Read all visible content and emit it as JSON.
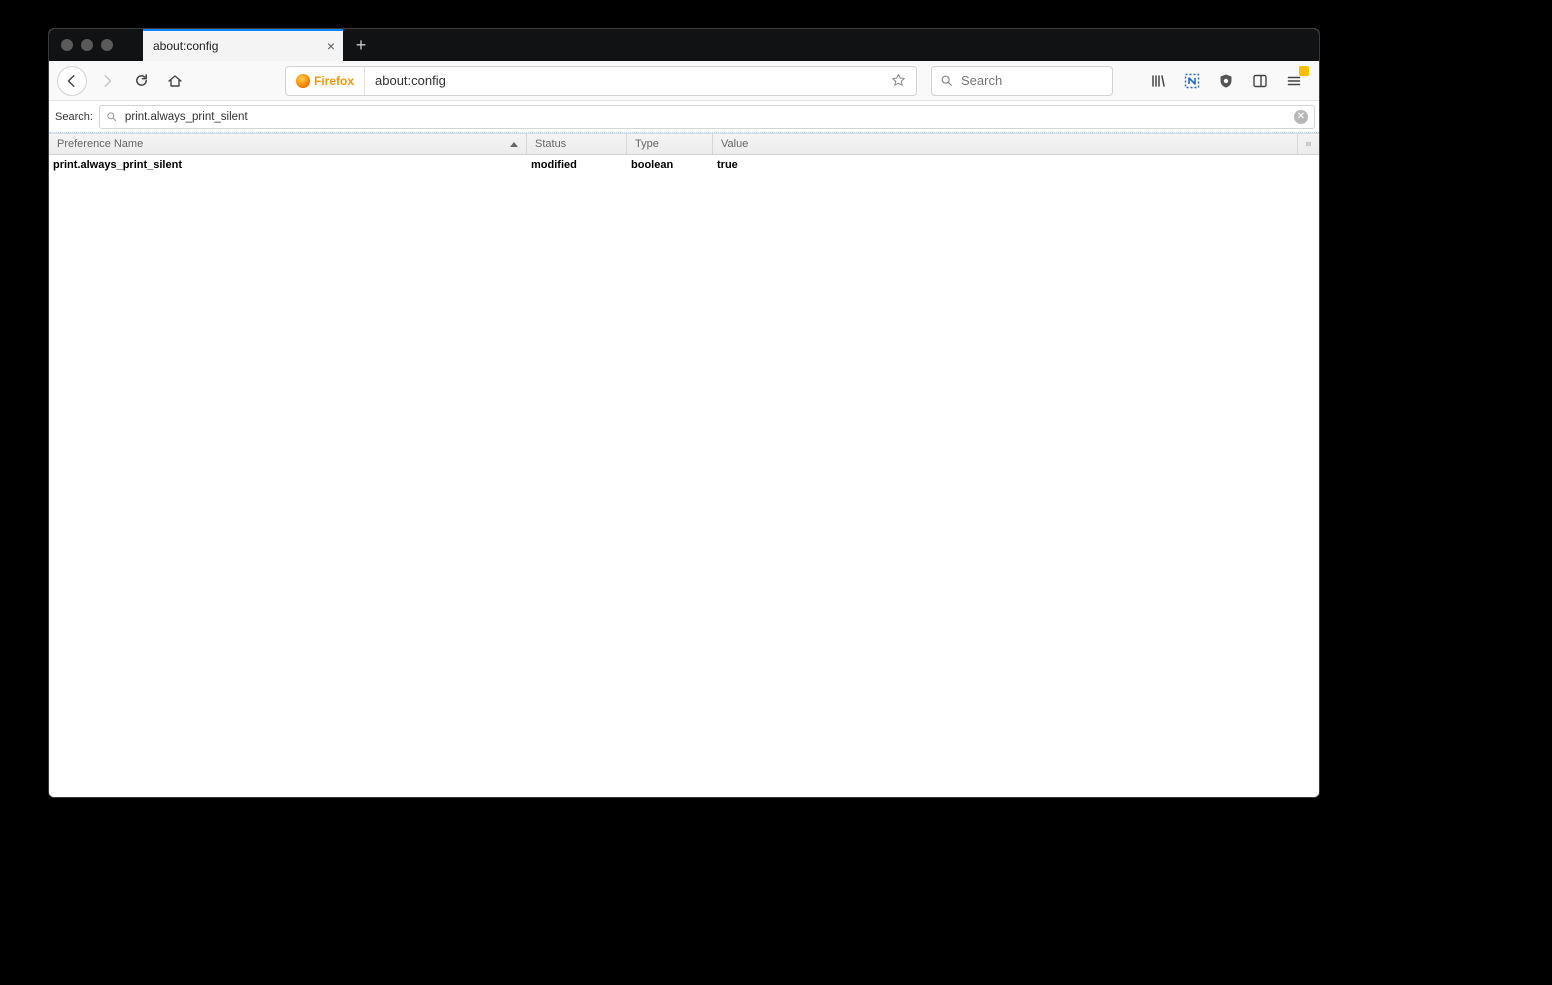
{
  "tab": {
    "title": "about:config"
  },
  "nav": {
    "identity_label": "Firefox",
    "url": "about:config",
    "search_placeholder": "Search"
  },
  "configsearch": {
    "label": "Search:",
    "value": "print.always_print_silent"
  },
  "headers": {
    "name": "Preference Name",
    "status": "Status",
    "type": "Type",
    "value": "Value"
  },
  "rows": [
    {
      "name": "print.always_print_silent",
      "status": "modified",
      "type": "boolean",
      "value": "true"
    }
  ]
}
